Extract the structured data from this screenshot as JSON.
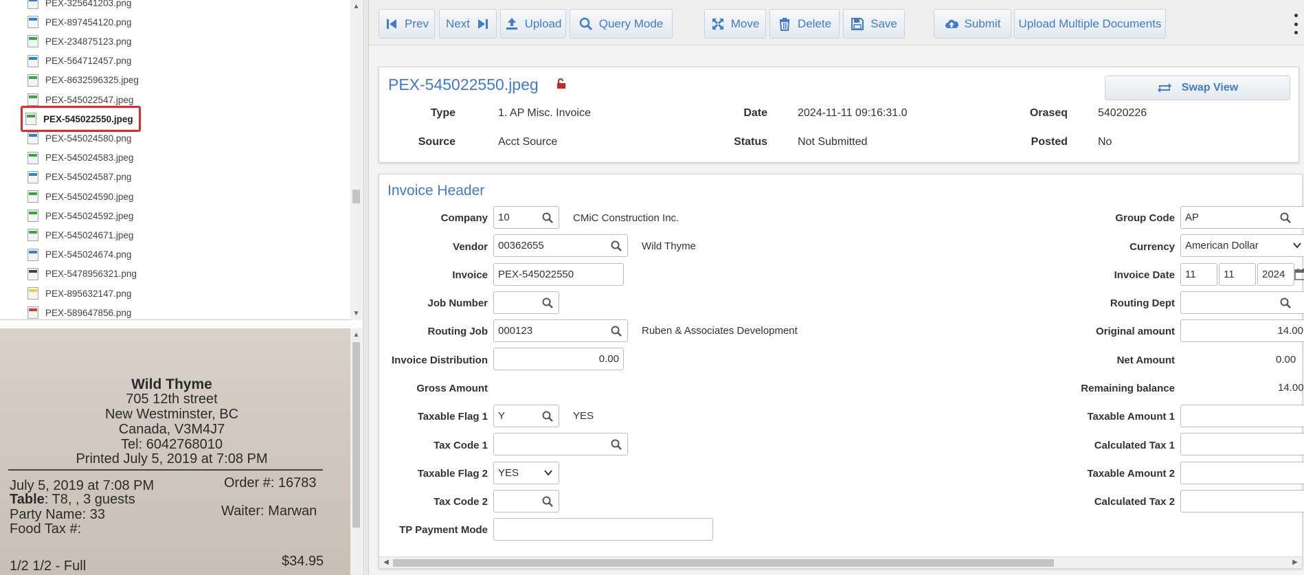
{
  "file_list": {
    "items": [
      {
        "name": "PEX-325641203.png",
        "type": "png"
      },
      {
        "name": "PEX-897454120.png",
        "type": "png"
      },
      {
        "name": "PEX-234875123.png",
        "type": "jpeg"
      },
      {
        "name": "PEX-564712457.png",
        "type": "png"
      },
      {
        "name": "PEX-8632596325.jpeg",
        "type": "jpeg"
      },
      {
        "name": "PEX-545022547.jpeg",
        "type": "jpeg"
      },
      {
        "name": "PEX-545022550.jpeg",
        "type": "jpeg",
        "selected": true
      },
      {
        "name": "PEX-545024580.png",
        "type": "png"
      },
      {
        "name": "PEX-545024583.jpeg",
        "type": "jpeg"
      },
      {
        "name": "PEX-545024587.png",
        "type": "png"
      },
      {
        "name": "PEX-545024590.jpeg",
        "type": "jpeg"
      },
      {
        "name": "PEX-545024592.jpeg",
        "type": "jpeg"
      },
      {
        "name": "PEX-545024671.jpeg",
        "type": "jpeg"
      },
      {
        "name": "PEX-545024674.png",
        "type": "png"
      },
      {
        "name": "PEX-5478956321.png",
        "type": "unknown"
      },
      {
        "name": "PEX-895632147.png",
        "type": "doc"
      },
      {
        "name": "PEX-589647856.png",
        "type": "red"
      }
    ]
  },
  "receipt": {
    "restaurant": "Wild Thyme",
    "street": "705 12th street",
    "city": "New Westminster, BC",
    "country": "Canada, V3M4J7",
    "tel": "Tel: 6042768010",
    "printed": "Printed July 5, 2019 at 7:08 PM",
    "date": "July 5, 2019 at 7:08 PM",
    "order": "Order #: 16783",
    "table_label": "Table",
    "table_value": ": T8, , 3 guests",
    "party": "Party Name: 33",
    "waiter": "Waiter: Marwan",
    "food_tax": "Food Tax #:",
    "item_name": "1/2 1/2 - Full",
    "item_price": "$34.95"
  },
  "toolbar": {
    "prev": "Prev",
    "next": "Next",
    "upload": "Upload",
    "query_mode": "Query Mode",
    "move": "Move",
    "delete": "Delete",
    "save": "Save",
    "submit": "Submit",
    "upload_multiple": "Upload Multiple Documents"
  },
  "document": {
    "title": "PEX-545022550.jpeg",
    "swap_view": "Swap View",
    "type_label": "Type",
    "type_value": "1. AP Misc. Invoice",
    "date_label": "Date",
    "date_value": "2024-11-11 09:16:31.0",
    "oraseq_label": "Oraseq",
    "oraseq_value": "54020226",
    "source_label": "Source",
    "source_value": "Acct Source",
    "status_label": "Status",
    "status_value": "Not Submitted",
    "posted_label": "Posted",
    "posted_value": "No"
  },
  "invoice_header": {
    "title": "Invoice Header",
    "company_label": "Company",
    "company_value": "10",
    "company_name": "CMiC Construction Inc.",
    "vendor_label": "Vendor",
    "vendor_value": "00362655",
    "vendor_name": "Wild Thyme",
    "invoice_label": "Invoice",
    "invoice_value": "PEX-545022550",
    "job_number_label": "Job Number",
    "job_number_value": "",
    "routing_job_label": "Routing Job",
    "routing_job_value": "000123",
    "routing_job_name": "Ruben & Associates Development",
    "invoice_distribution_label": "Invoice Distribution",
    "invoice_distribution_value": "0.00",
    "gross_amount_label": "Gross Amount",
    "taxable_flag1_label": "Taxable Flag 1",
    "taxable_flag1_value": "Y",
    "taxable_flag1_desc": "YES",
    "tax_code1_label": "Tax Code 1",
    "tax_code1_value": "",
    "taxable_flag2_label": "Taxable Flag 2",
    "taxable_flag2_value": "YES",
    "tax_code2_label": "Tax Code 2",
    "tax_code2_value": "",
    "tp_payment_mode_label": "TP Payment Mode",
    "tp_payment_mode_value": "",
    "group_code_label": "Group Code",
    "group_code_value": "AP",
    "currency_label": "Currency",
    "currency_value": "American Dollar",
    "invoice_date_label": "Invoice Date",
    "invoice_date_month": "11",
    "invoice_date_day": "11",
    "invoice_date_year": "2024",
    "routing_dept_label": "Routing Dept",
    "routing_dept_value": "",
    "original_amount_label": "Original amount",
    "original_amount_value": "14.00",
    "net_amount_label": "Net Amount",
    "net_amount_value": "0.00",
    "remaining_balance_label": "Remaining balance",
    "remaining_balance_value": "14.00",
    "taxable_amount1_label": "Taxable Amount 1",
    "calculated_tax1_label": "Calculated Tax 1",
    "taxable_amount2_label": "Taxable Amount 2",
    "calculated_tax2_label": "Calculated Tax 2"
  },
  "colors": {
    "accent": "#3e7bd4",
    "selection_border": "#e12a2a"
  }
}
